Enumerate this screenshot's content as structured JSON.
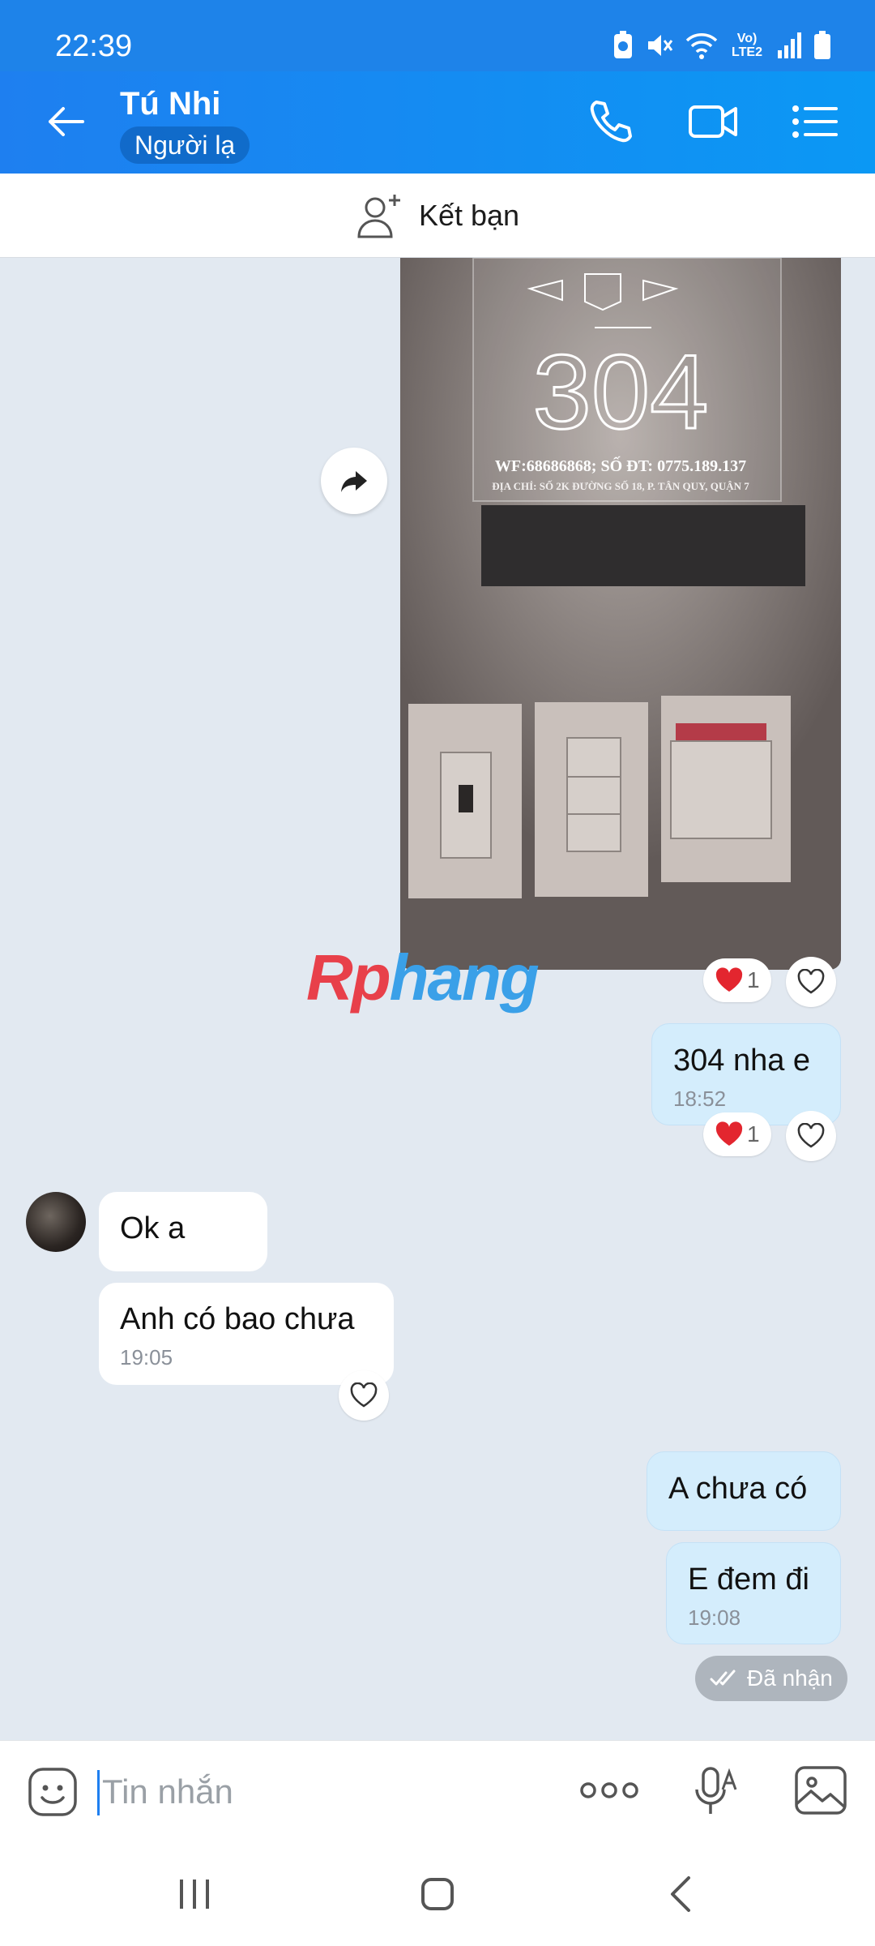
{
  "status_bar": {
    "time": "22:39",
    "network_label": "Vo) LTE2"
  },
  "header": {
    "title": "Tú Nhi",
    "subtitle": "Người lạ"
  },
  "friend_bar": {
    "label": "Kết bạn"
  },
  "photo": {
    "sign_number": "304",
    "sign_line1": "WF:68686868; SỐ ĐT: 0775.189.137",
    "sign_line2": "ĐỊA CHỈ: SỐ 2K ĐƯỜNG SỐ 18, P. TÂN QUY, QUẬN 7"
  },
  "watermark": {
    "part1": "Rp",
    "part2": "hang"
  },
  "messages": [
    {
      "text": "304 nha e",
      "time": "18:52"
    },
    {
      "text": "Ok a"
    },
    {
      "text": "Anh có bao chưa",
      "time": "19:05"
    },
    {
      "text": "A chưa có"
    },
    {
      "text": "E đem đi",
      "time": "19:08"
    }
  ],
  "reactions": {
    "photo_count": "1",
    "msg1_count": "1"
  },
  "read_status": "Đã nhận",
  "input": {
    "placeholder": "Tin nhắn"
  },
  "colors": {
    "header": "#1e7ff0",
    "out_bubble": "#d4edfc",
    "in_bubble": "#ffffff",
    "chat_bg": "#e2e9f1"
  }
}
